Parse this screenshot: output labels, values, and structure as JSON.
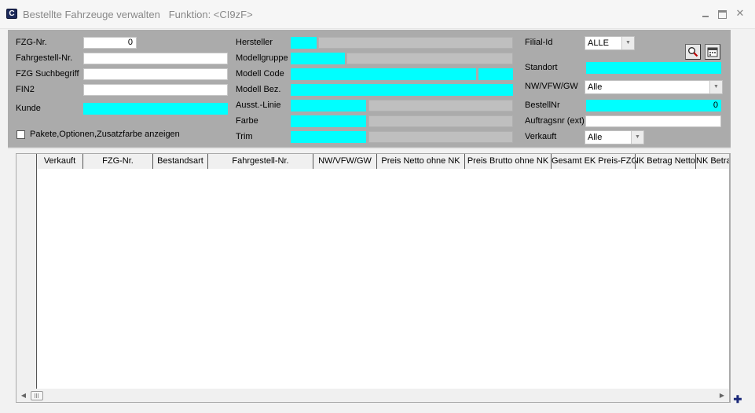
{
  "window": {
    "title": "Bestellte Fahrzeuge verwalten",
    "function_label": "Funktion: <CI9zF>",
    "app_icon_letter": "C",
    "close_glyph": "✕"
  },
  "left": {
    "fzg_nr_label": "FZG-Nr.",
    "fzg_nr_value": "0",
    "fahrgestell_label": "Fahrgestell-Nr.",
    "fahrgestell_value": "",
    "suchbegriff_label": "FZG Suchbegriff",
    "suchbegriff_value": "",
    "fin2_label": "FIN2",
    "fin2_value": "",
    "kunde_label": "Kunde",
    "checkbox_label": "Pakete,Optionen,Zusatzfarbe anzeigen"
  },
  "middle": {
    "hersteller_label": "Hersteller",
    "modellgruppe_label": "Modellgruppe",
    "modellcode_label": "Modell Code",
    "modellbez_label": "Modell Bez.",
    "ausst_linie_label": "Ausst.-Linie",
    "farbe_label": "Farbe",
    "trim_label": "Trim"
  },
  "right": {
    "filial_label": "Filial-Id",
    "filial_value": "ALLE",
    "standort_label": "Standort",
    "nwvfwgw_label": "NW/VFW/GW",
    "nwvfwgw_value": "Alle",
    "bestellnr_label": "BestellNr",
    "bestellnr_value": "0",
    "auftragsnr_label": "Auftragsnr (ext)",
    "auftragsnr_value": "",
    "verkauft_label": "Verkauft",
    "verkauft_value": "Alle"
  },
  "icons": {
    "search": "magnifier-icon",
    "calendar": "calendar-icon",
    "dropdown": "▼",
    "scroll_left": "◀",
    "scroll_right": "▶",
    "corner": "✚"
  },
  "table": {
    "columns": [
      "Verkauft",
      "FZG-Nr.",
      "Bestandsart",
      "Fahrgestell-Nr.",
      "NW/VFW/GW",
      "Preis Netto ohne NK",
      "Preis Brutto ohne NK",
      "Gesamt EK Preis-FZG",
      "NK Betrag Netto",
      "NK Betrag"
    ],
    "rows": []
  },
  "colors": {
    "highlight_field": "#00ffff",
    "panel_bg": "#ababab",
    "disabled_field": "#bfbfbf"
  }
}
